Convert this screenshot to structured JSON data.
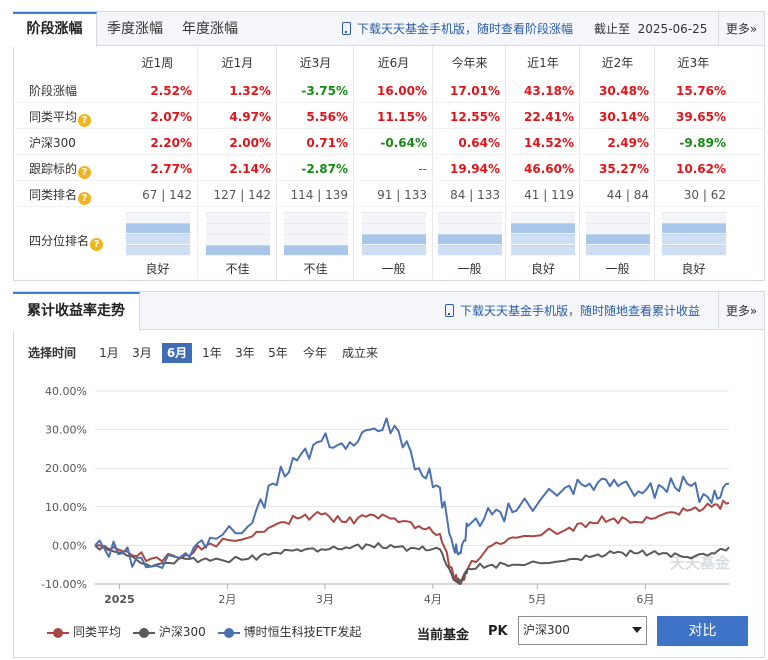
{
  "top": {
    "tabs": [
      "阶段涨幅",
      "季度涨幅",
      "年度涨幅"
    ],
    "download_text": "下载天天基金手机版，随时查看阶段涨幅",
    "asof_label": "截止至",
    "asof_date": "2025-06-25",
    "more": "更多»"
  },
  "table": {
    "periods": [
      "近1周",
      "近1月",
      "近3月",
      "近6月",
      "今年来",
      "近1年",
      "近2年",
      "近3年"
    ],
    "rows": [
      {
        "label": "阶段涨幅",
        "help": false,
        "values": [
          [
            "2.52%",
            "red"
          ],
          [
            "1.32%",
            "red"
          ],
          [
            "-3.75%",
            "grn"
          ],
          [
            "16.00%",
            "red"
          ],
          [
            "17.01%",
            "red"
          ],
          [
            "43.18%",
            "red"
          ],
          [
            "30.48%",
            "red"
          ],
          [
            "15.76%",
            "red"
          ]
        ]
      },
      {
        "label": "同类平均",
        "help": true,
        "values": [
          [
            "2.07%",
            "red"
          ],
          [
            "4.97%",
            "red"
          ],
          [
            "5.56%",
            "red"
          ],
          [
            "11.15%",
            "red"
          ],
          [
            "12.55%",
            "red"
          ],
          [
            "22.41%",
            "red"
          ],
          [
            "30.14%",
            "red"
          ],
          [
            "39.65%",
            "red"
          ]
        ]
      },
      {
        "label": "沪深300",
        "help": false,
        "values": [
          [
            "2.20%",
            "red"
          ],
          [
            "2.00%",
            "red"
          ],
          [
            "0.71%",
            "red"
          ],
          [
            "-0.64%",
            "grn"
          ],
          [
            "0.64%",
            "red"
          ],
          [
            "14.52%",
            "red"
          ],
          [
            "2.49%",
            "red"
          ],
          [
            "-9.89%",
            "grn"
          ]
        ]
      },
      {
        "label": "跟踪标的",
        "help": true,
        "values": [
          [
            "2.77%",
            "red"
          ],
          [
            "2.14%",
            "red"
          ],
          [
            "-2.87%",
            "grn"
          ],
          [
            "--",
            "gry"
          ],
          [
            "19.94%",
            "red"
          ],
          [
            "46.60%",
            "red"
          ],
          [
            "35.27%",
            "red"
          ],
          [
            "10.62%",
            "red"
          ]
        ]
      },
      {
        "label": "同类排名",
        "help": true,
        "values": [
          [
            "67 | 142",
            "gry"
          ],
          [
            "127 | 142",
            "gry"
          ],
          [
            "114 | 139",
            "gry"
          ],
          [
            "91 | 133",
            "gry"
          ],
          [
            "84 | 133",
            "gry"
          ],
          [
            "41 | 119",
            "gry"
          ],
          [
            "44 | 84",
            "gry"
          ],
          [
            "30 | 62",
            "gry"
          ]
        ]
      }
    ],
    "quartile_label": "四分位排名",
    "quartile_levels": [
      3,
      1,
      1,
      2,
      2,
      3,
      2,
      3
    ],
    "quartile_text": [
      "良好",
      "不佳",
      "不佳",
      "一般",
      "一般",
      "良好",
      "一般",
      "良好"
    ]
  },
  "chart_section": {
    "title": "累计收益率走势",
    "download_text": "下载天天基金手机版，随时随地查看累计收益",
    "more": "更多»",
    "select_label": "选择时间",
    "ranges": [
      "1月",
      "3月",
      "6月",
      "1年",
      "3年",
      "5年",
      "今年",
      "成立来"
    ],
    "selected_range": "6月",
    "watermark": "天天基金"
  },
  "colors": {
    "fund": "#4a72b0",
    "avg": "#a94743",
    "hs300": "#5a5a5a",
    "up": "#e0151b",
    "down": "#178a14",
    "accent": "#3e74c7"
  },
  "chart_data": {
    "type": "line",
    "xlabel": "",
    "ylabel": "",
    "ylim": [
      -10,
      40
    ],
    "yticks": [
      "40.00%",
      "30.00%",
      "20.00%",
      "10.00%",
      "0.00%",
      "-10.00%"
    ],
    "xticks": [
      "2025",
      "2月",
      "3月",
      "4月",
      "5月",
      "6月"
    ],
    "x": [
      "2024-12-25",
      "2025-01-02",
      "2025-01-10",
      "2025-01-20",
      "2025-01-27",
      "2025-02-07",
      "2025-02-14",
      "2025-02-21",
      "2025-02-28",
      "2025-03-07",
      "2025-03-14",
      "2025-03-21",
      "2025-03-28",
      "2025-04-03",
      "2025-04-07",
      "2025-04-09",
      "2025-04-11",
      "2025-04-18",
      "2025-04-25",
      "2025-05-09",
      "2025-05-16",
      "2025-05-23",
      "2025-05-30",
      "2025-06-06",
      "2025-06-13",
      "2025-06-20",
      "2025-06-25"
    ],
    "series": [
      {
        "name": "同类平均",
        "color": "#a94743",
        "values": [
          0,
          -1.5,
          -3.5,
          -2.5,
          0.5,
          2,
          5,
          7,
          8,
          6,
          8,
          7,
          5,
          3,
          -8,
          -10,
          -6,
          0,
          2,
          4,
          6,
          7,
          6,
          8,
          9,
          10,
          11
        ]
      },
      {
        "name": "沪深300",
        "color": "#5a5a5a",
        "values": [
          0,
          -2,
          -5.5,
          -3.5,
          -4,
          -3.5,
          -2,
          -1,
          -1,
          -0.5,
          0,
          -0.5,
          -1,
          -1,
          -9,
          -9.5,
          -6,
          -5,
          -5,
          -4,
          -3,
          -2,
          -2,
          -2,
          -3,
          -2,
          -0.5
        ]
      },
      {
        "name": "博时恒生科技ETF发起",
        "color": "#4a72b0",
        "values": [
          0,
          -2,
          -5.5,
          -2,
          2,
          5,
          16,
          22,
          27,
          25,
          30,
          31,
          20,
          15,
          -1,
          -2,
          5,
          8,
          9,
          15,
          16,
          17,
          14,
          15,
          16,
          11,
          16
        ]
      }
    ],
    "grid": true,
    "legend": "bottom-left"
  },
  "compare": {
    "current_label": "当前基金",
    "pk_label": "PK",
    "selected": "沪深300",
    "button": "对比"
  }
}
